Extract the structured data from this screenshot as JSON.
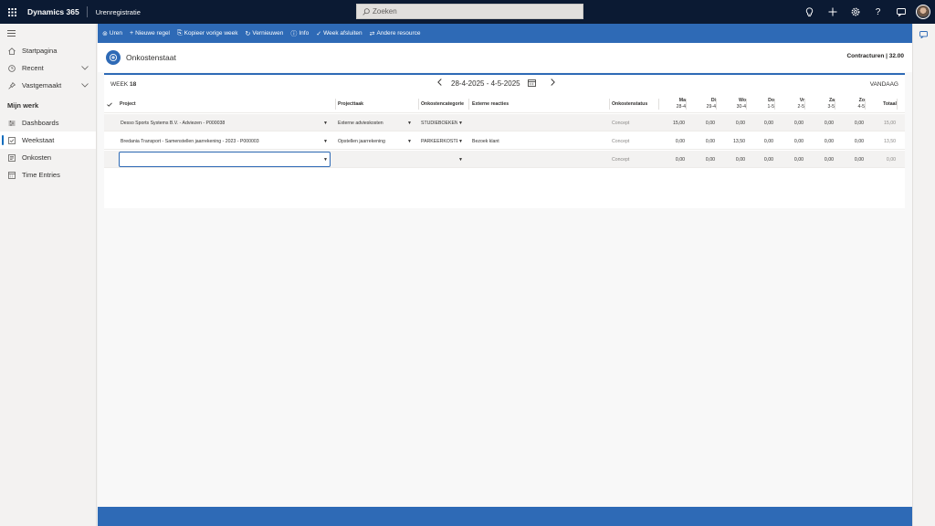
{
  "topbar": {
    "brand": "Dynamics 365",
    "app_name": "Urenregistratie",
    "search_placeholder": "Zoeken",
    "icons": [
      "lightbulb-icon",
      "plus-icon",
      "settings-icon",
      "help-icon",
      "chat-icon",
      "avatar"
    ]
  },
  "sidebar": {
    "items_top": [
      {
        "label": "Startpagina",
        "icon": "home-icon"
      },
      {
        "label": "Recent",
        "icon": "clock-icon",
        "chevron": true
      },
      {
        "label": "Vastgemaakt",
        "icon": "pin-icon",
        "chevron": true
      }
    ],
    "section_title": "Mijn werk",
    "items_work": [
      {
        "label": "Dashboards",
        "icon": "dashboard-icon"
      },
      {
        "label": "Weekstaat",
        "icon": "calendar-check-icon",
        "active": true
      },
      {
        "label": "Onkosten",
        "icon": "receipt-icon"
      },
      {
        "label": "Time Entries",
        "icon": "calendar-icon"
      }
    ]
  },
  "commands": [
    {
      "label": "Uren",
      "glyph": "⊚"
    },
    {
      "label": "Nieuwe regel",
      "glyph": "+"
    },
    {
      "label": "Kopieer vorige week",
      "glyph": "⎘"
    },
    {
      "label": "Vernieuwen",
      "glyph": "↻"
    },
    {
      "label": "Info",
      "glyph": "ⓘ"
    },
    {
      "label": "Week afsluiten",
      "glyph": "✓"
    },
    {
      "label": "Andere resource",
      "glyph": "⇄"
    }
  ],
  "page": {
    "title": "Onkostenstaat",
    "contract_label": "Contracturen | 32.00"
  },
  "week": {
    "prefix": "WEEK",
    "number": "18",
    "range": "28-4-2025 - 4-5-2025",
    "today": "VANDAAG"
  },
  "columns": {
    "project": "Project",
    "projecttaak": "Projecttaak",
    "categorie": "Onkostencategorie",
    "reacties": "Externe reacties",
    "status": "Onkostenstatus",
    "days": [
      {
        "d": "Ma",
        "date": "28-4"
      },
      {
        "d": "Di",
        "date": "29-4"
      },
      {
        "d": "Wo",
        "date": "30-4"
      },
      {
        "d": "Do",
        "date": "1-5"
      },
      {
        "d": "Vr",
        "date": "2-5"
      },
      {
        "d": "Za",
        "date": "3-5"
      },
      {
        "d": "Zo",
        "date": "4-5"
      }
    ],
    "total": "Totaal"
  },
  "rows": [
    {
      "project": "Desso Sports Systems B.V. - Adviezen - P000038",
      "task": "Externe advieskosten",
      "category": "STUDIEBOEKEN",
      "comment": "",
      "status": "Concept",
      "values": [
        "15,00",
        "0,00",
        "0,00",
        "0,00",
        "0,00",
        "0,00",
        "0,00"
      ],
      "total": "15,00"
    },
    {
      "project": "Bredania Transport - Samenstellen jaarrekening - 2023 - P000003",
      "task": "Opstellen jaarrekening",
      "category": "PARKEERKOSTEN",
      "comment": "Bezoek klant",
      "status": "Concept",
      "values": [
        "0,00",
        "0,00",
        "13,50",
        "0,00",
        "0,00",
        "0,00",
        "0,00"
      ],
      "total": "13,50"
    },
    {
      "project": "",
      "task": "",
      "category": "",
      "comment": "",
      "status": "Concept",
      "values": [
        "0,00",
        "0,00",
        "0,00",
        "0,00",
        "0,00",
        "0,00",
        "0,00"
      ],
      "total": "0,00"
    }
  ]
}
